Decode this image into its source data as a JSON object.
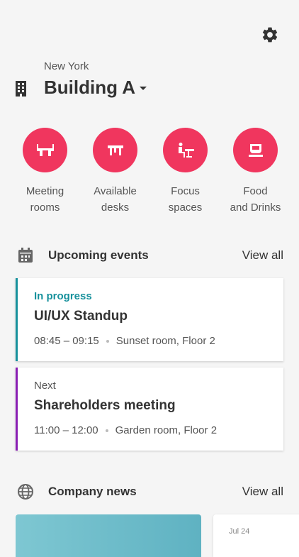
{
  "header": {
    "location": "New York",
    "building": "Building A"
  },
  "quick_actions": [
    {
      "label": "Meeting\nrooms",
      "icon": "meeting-room-icon"
    },
    {
      "label": "Available\ndesks",
      "icon": "desk-icon"
    },
    {
      "label": "Focus\nspaces",
      "icon": "focus-space-icon"
    },
    {
      "label": "Food\nand Drinks",
      "icon": "food-drinks-icon"
    }
  ],
  "events": {
    "title": "Upcoming events",
    "view_all": "View all",
    "items": [
      {
        "status": "In progress",
        "title": "UI/UX Standup",
        "time": "08:45 – 09:15",
        "location": "Sunset room, Floor 2",
        "accent": "#17919c"
      },
      {
        "status": "Next",
        "title": "Shareholders meeting",
        "time": "11:00 – 12:00",
        "location": "Garden room, Floor 2",
        "accent": "#8a1eb4"
      }
    ]
  },
  "news": {
    "title": "Company news",
    "view_all": "View all",
    "peek_date": "Jul 24"
  },
  "colors": {
    "accent": "#f0365e",
    "background": "#f5f5f5"
  }
}
